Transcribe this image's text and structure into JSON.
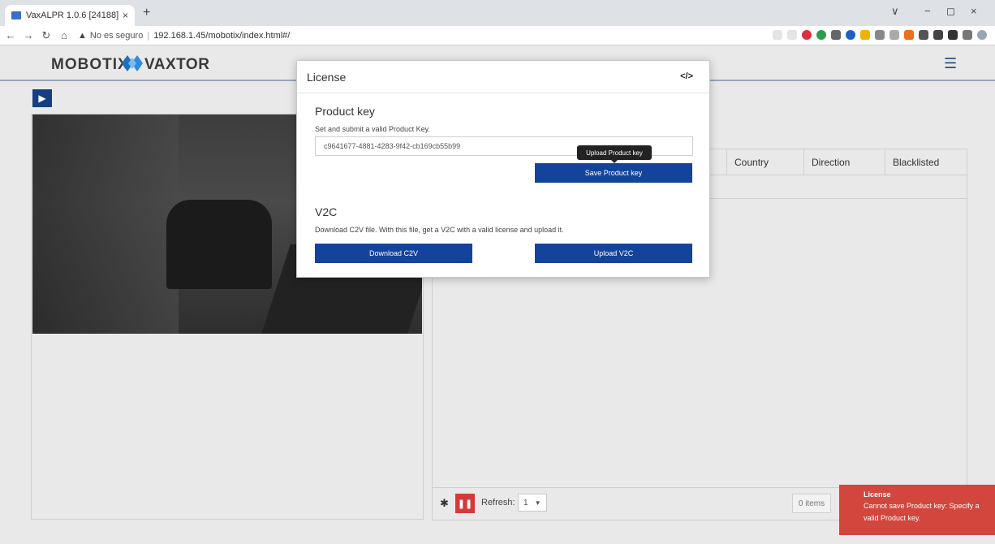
{
  "browser": {
    "tab_title": "VaxALPR 1.0.6 [24188]",
    "tab_close": "×",
    "new_tab": "+",
    "address": {
      "insecure_label": "No es seguro",
      "url": "192.168.1.45/mobotix/index.html#/"
    },
    "window_controls": [
      "∨",
      "−",
      "◻",
      "×"
    ]
  },
  "header": {
    "brand_left": "MOBOTIX",
    "brand_right": "VAXTOR",
    "menu_icon": "hamburger-icon"
  },
  "table": {
    "columns": [
      "Country",
      "Direction",
      "Blacklisted"
    ]
  },
  "footer": {
    "refresh_label": "Refresh:",
    "refresh_value": "1",
    "items_count": "0 items"
  },
  "modal": {
    "title": "License",
    "code_icon": "</>",
    "product_key": {
      "title": "Product key",
      "description": "Set and submit a valid Product Key.",
      "input_value": "c9641677-4881-4283-9f42-cb169cb55b99",
      "tooltip": "Upload Product key",
      "save_label": "Save Product key"
    },
    "v2c": {
      "title": "V2C",
      "description": "Download C2V file. With this file, get a V2C with a valid license and upload it.",
      "download_label": "Download C2V",
      "upload_label": "Upload V2C"
    }
  },
  "toast": {
    "title": "License",
    "message": "Cannot save Product key: Specify a valid Product key."
  },
  "colors": {
    "primary": "#14439b",
    "danger": "#d2463d",
    "play": "#163e84"
  }
}
